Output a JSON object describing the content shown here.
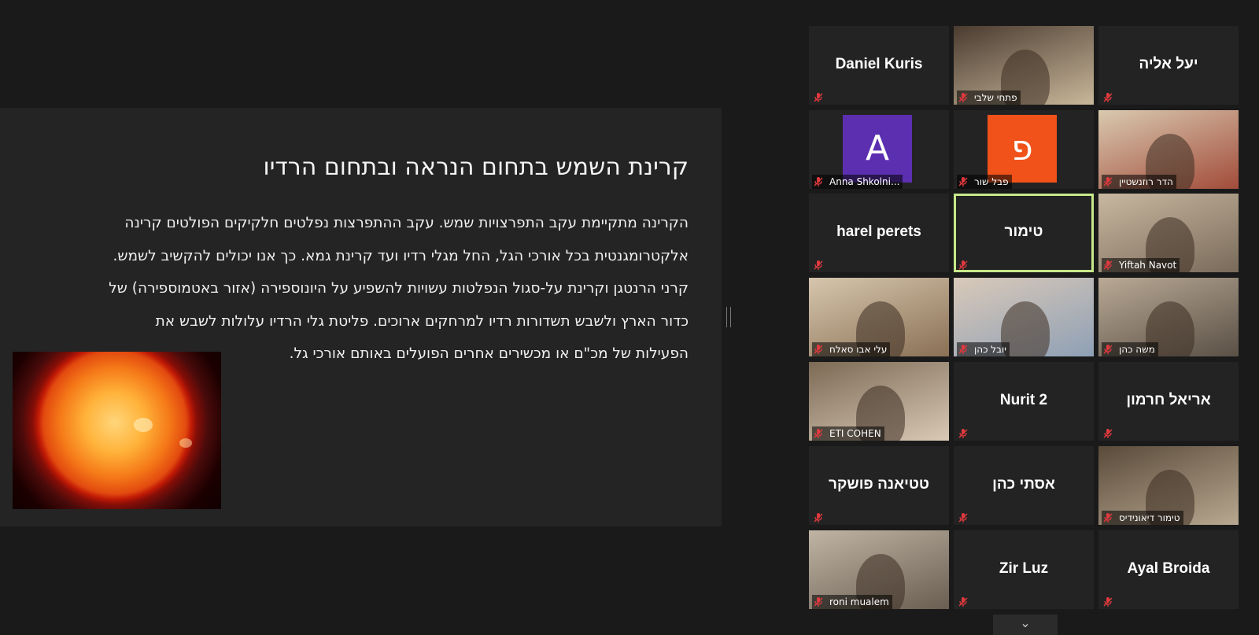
{
  "slide": {
    "title": "קרינת השמש בתחום הנראה ובתחום הרדיו",
    "lines": [
      "הקרינה מתקיימת עקב התפרצויות שמש. עקב ההתפרצות נפלטים חלקיקים הפולטים קרינה",
      "אלקטרומגנטית בכל אורכי הגל, החל מגלי רדיו ועד קרינת גמא. כך אנו יכולים להקשיב לשמש.",
      "קרני הרנטגן וקרינת על-סגול הנפלטות עשויות להשפיע על היונוספירה (אזור באטמוספירה) של",
      "כדור הארץ ולשבש תשדורות רדיו למרחקים ארוכים. פליטת גלי הרדיו עלולות לשבש את",
      "הפעילות של מכ\"ם או מכשירים אחרים הפועלים באותם אורכי גל."
    ],
    "image": "sun-image"
  },
  "participants": [
    {
      "name": "Daniel Kuris",
      "type": "name"
    },
    {
      "name": "פתחי שלבי",
      "type": "video"
    },
    {
      "name": "יעל אליה",
      "type": "name"
    },
    {
      "name": "Anna Shkolni...",
      "type": "avatar",
      "initial": "A",
      "color": "#5b2fb0"
    },
    {
      "name": "פבל שור",
      "type": "avatar",
      "initial": "פ",
      "color": "#f0521a"
    },
    {
      "name": "הדר רוזנשטיין",
      "type": "video"
    },
    {
      "name": "harel perets",
      "type": "name"
    },
    {
      "name": "טימור",
      "type": "name",
      "active": true
    },
    {
      "name": "Yiftah Navot",
      "type": "video"
    },
    {
      "name": "עלי אבו סאלח",
      "type": "video"
    },
    {
      "name": "יובל כהן",
      "type": "video"
    },
    {
      "name": "משה כהן",
      "type": "video"
    },
    {
      "name": "ETI COHEN",
      "type": "video"
    },
    {
      "name": "Nurit 2",
      "type": "name"
    },
    {
      "name": "אריאל חרמון",
      "type": "name"
    },
    {
      "name": "טטיאנה פושקר",
      "type": "name"
    },
    {
      "name": "אסתי כהן",
      "type": "name"
    },
    {
      "name": "טימור דיאונידיס",
      "type": "video"
    },
    {
      "name": "roni mualem",
      "type": "video"
    },
    {
      "name": "Zir Luz",
      "type": "name"
    },
    {
      "name": "Ayal Broida",
      "type": "name"
    }
  ],
  "colors": {
    "mic_muted": "#e0393e",
    "active_speaker": "#c7e88a"
  },
  "icons": {
    "mic": "mic-muted-icon",
    "scroll": "chevron-down-icon"
  },
  "controls": {
    "scroll_down": "⌄"
  }
}
